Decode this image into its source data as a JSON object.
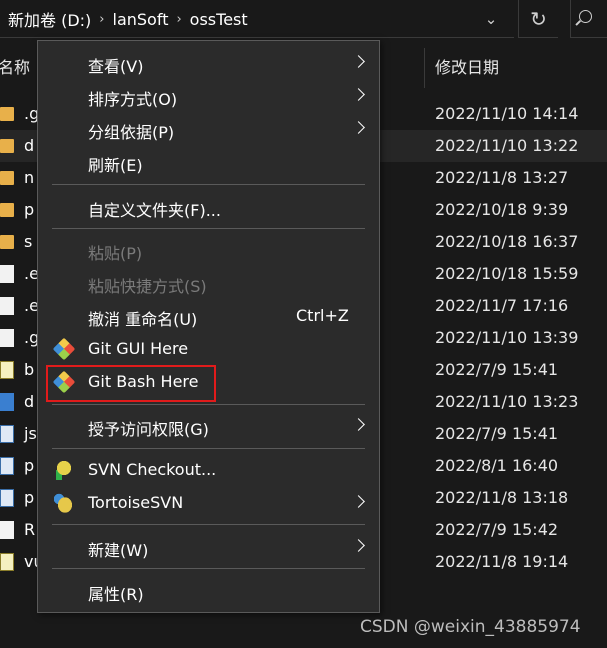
{
  "address": {
    "breadcrumbs": [
      "新加卷 (D:)",
      "lanSoft",
      "ossTest"
    ],
    "separator_glyph": "›",
    "dropdown_glyph": "⌄",
    "refresh_glyph": "↻"
  },
  "columns": {
    "name": "名称",
    "modified": "修改日期"
  },
  "files": [
    {
      "name": ".g",
      "icon": "folder-icon",
      "date": "2022/11/10 14:14"
    },
    {
      "name": "d",
      "icon": "folder-icon",
      "date": "2022/11/10 13:22"
    },
    {
      "name": "n",
      "icon": "folder-icon",
      "date": "2022/11/8 13:27"
    },
    {
      "name": "p",
      "icon": "folder-icon",
      "date": "2022/10/18 9:39"
    },
    {
      "name": "s",
      "icon": "folder-icon",
      "date": "2022/10/18 16:37"
    },
    {
      "name": ".e",
      "icon": "file-icon",
      "date": "2022/10/18 15:59"
    },
    {
      "name": ".e",
      "icon": "file-icon",
      "date": "2022/11/7 17:16"
    },
    {
      "name": ".g",
      "icon": "file-icon",
      "date": "2022/11/10 13:39"
    },
    {
      "name": "b",
      "icon": "js-file-icon",
      "date": "2022/7/9 15:41"
    },
    {
      "name": "d",
      "icon": "blue-folder-icon",
      "date": "2022/11/10 13:23"
    },
    {
      "name": "js",
      "icon": "json-file-icon",
      "date": "2022/7/9 15:41"
    },
    {
      "name": "p",
      "icon": "json-file-icon",
      "date": "2022/8/1 16:40"
    },
    {
      "name": "p",
      "icon": "json-file-icon",
      "date": "2022/11/8 13:18"
    },
    {
      "name": "R",
      "icon": "markdown-file-icon",
      "date": "2022/7/9 15:42"
    },
    {
      "name": "vu",
      "icon": "js-file-icon",
      "date": "2022/11/8 19:14"
    }
  ],
  "menu": {
    "view": "查看(V)",
    "sort": "排序方式(O)",
    "group": "分组依据(P)",
    "refresh": "刷新(E)",
    "customize": "自定义文件夹(F)...",
    "paste": "粘贴(P)",
    "paste_shortcut": "粘贴快捷方式(S)",
    "undo": "撤消 重命名(U)",
    "undo_shortcut": "Ctrl+Z",
    "git_gui": "Git GUI Here",
    "git_bash": "Git Bash Here",
    "grant_access": "授予访问权限(G)",
    "svn_checkout": "SVN Checkout...",
    "tortoise_svn": "TortoiseSVN",
    "new": "新建(W)",
    "properties": "属性(R)"
  },
  "colors": {
    "background": "#191919",
    "menu_bg": "#2b2b2b",
    "highlight": "#e11b1b"
  },
  "watermark": "CSDN @weixin_43885974"
}
